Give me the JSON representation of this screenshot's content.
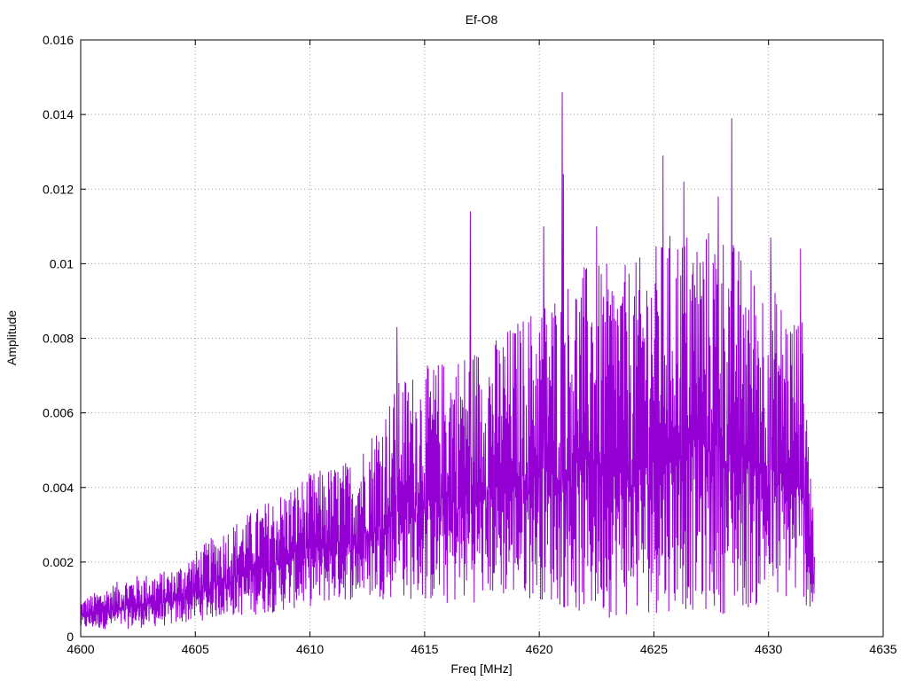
{
  "chart_data": {
    "type": "line",
    "title": "Ef-O8",
    "xlabel": "Freq [MHz]",
    "ylabel": "Amplitude",
    "xlim": [
      4600,
      4635
    ],
    "ylim": [
      0,
      0.016
    ],
    "xticks": [
      4600,
      4605,
      4610,
      4615,
      4620,
      4625,
      4630,
      4635
    ],
    "yticks": [
      0,
      0.002,
      0.004,
      0.006,
      0.008,
      0.01,
      0.012,
      0.014,
      0.016
    ],
    "ytick_labels": [
      "0",
      "0.002",
      "0.004",
      "0.006",
      "0.008",
      "0.01",
      "0.012",
      "0.014",
      "0.016"
    ],
    "grid": true,
    "legend": "none",
    "series": [
      {
        "color": "#9400d3",
        "x_range": [
          4600,
          4632
        ],
        "envelope": {
          "x": [
            4600,
            4602,
            4604,
            4606,
            4608,
            4610,
            4612,
            4614,
            4616,
            4618,
            4620,
            4622,
            4624,
            4626,
            4628,
            4630,
            4631.5,
            4632
          ],
          "min": [
            0.0002,
            0.0002,
            0.0003,
            0.0005,
            0.0006,
            0.0008,
            0.001,
            0.001,
            0.0008,
            0.001,
            0.001,
            0.0005,
            0.0005,
            0.0007,
            0.0006,
            0.0008,
            0.001,
            0.0003
          ],
          "max": [
            0.001,
            0.0016,
            0.0018,
            0.0028,
            0.0036,
            0.0044,
            0.0048,
            0.007,
            0.0075,
            0.008,
            0.009,
            0.01,
            0.01,
            0.011,
            0.011,
            0.0095,
            0.0085,
            0.003
          ]
        },
        "peaks": [
          {
            "x": 4617.0,
            "y": 0.0114
          },
          {
            "x": 4613.8,
            "y": 0.0083
          },
          {
            "x": 4620.2,
            "y": 0.011
          },
          {
            "x": 4621.0,
            "y": 0.0146
          },
          {
            "x": 4621.05,
            "y": 0.0124
          },
          {
            "x": 4622.5,
            "y": 0.011
          },
          {
            "x": 4625.4,
            "y": 0.0129
          },
          {
            "x": 4626.3,
            "y": 0.0122
          },
          {
            "x": 4627.8,
            "y": 0.0118
          },
          {
            "x": 4628.4,
            "y": 0.0139
          },
          {
            "x": 4630.1,
            "y": 0.0107
          },
          {
            "x": 4631.4,
            "y": 0.0104
          }
        ]
      }
    ]
  }
}
